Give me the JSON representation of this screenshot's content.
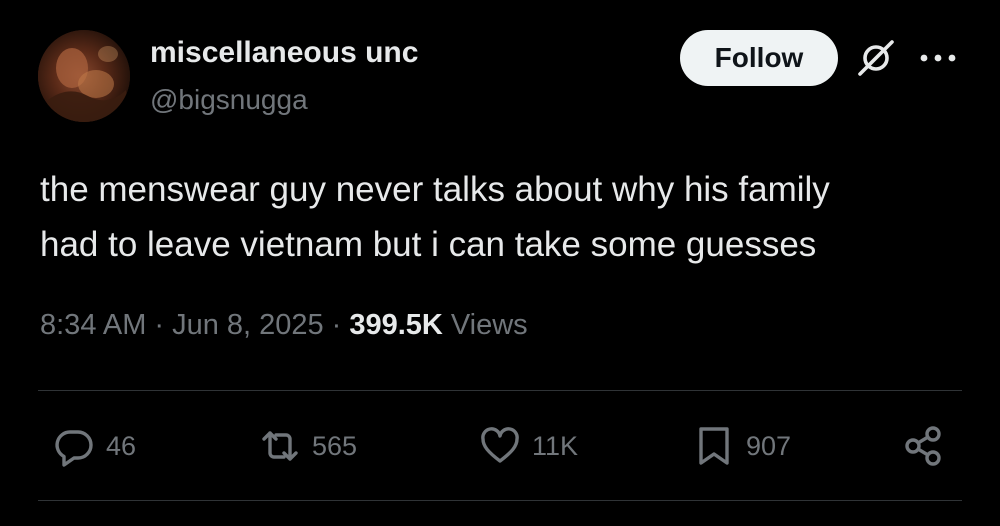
{
  "author": {
    "display_name": "miscellaneous unc",
    "handle": "@bigsnugga",
    "avatar": "profile-photo"
  },
  "header": {
    "follow_label": "Follow",
    "grok_icon": "grok-icon",
    "more_icon": "more-dots-icon"
  },
  "tweet": {
    "text_line1": "the menswear guy never talks about why his family",
    "text_line2": "had to leave vietnam but i can take some guesses",
    "time": "8:34 AM",
    "date": "Jun 8, 2025",
    "views_count": "399.5K",
    "views_label": "Views"
  },
  "actions": {
    "replies": "46",
    "retweets": "565",
    "likes": "11K",
    "bookmarks": "907"
  },
  "colors": {
    "background": "#000000",
    "text": "#e7e9ea",
    "secondary": "#71767b",
    "divider": "#2f3336",
    "follow_bg": "#eff3f4"
  }
}
